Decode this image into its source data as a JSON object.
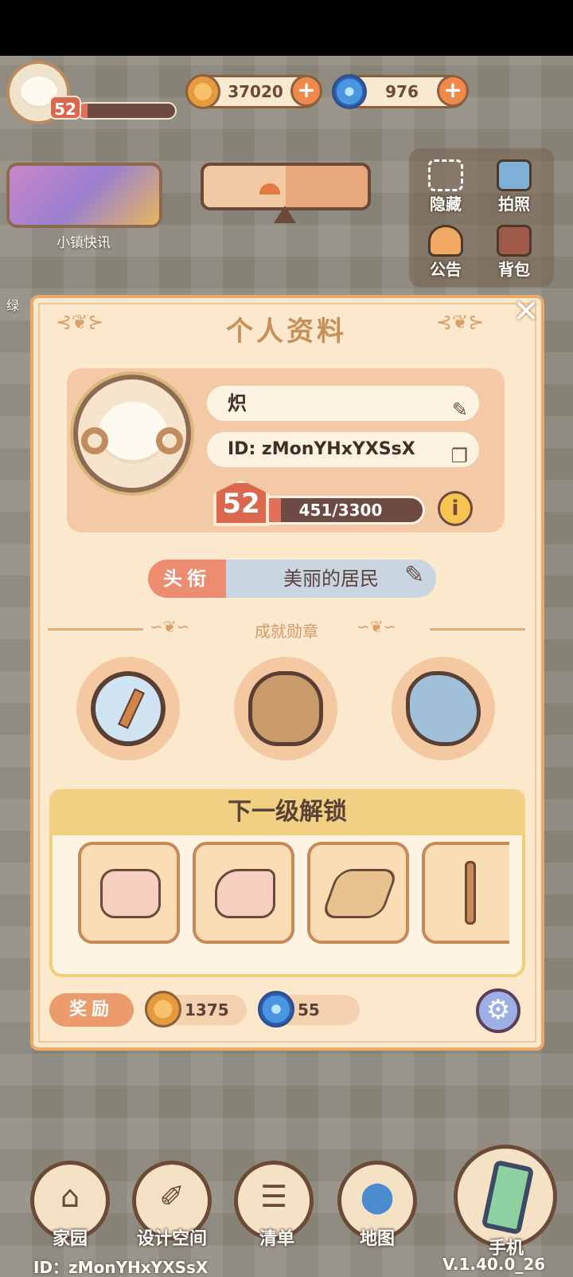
{
  "hud": {
    "level": "52",
    "level_progress": 0.1,
    "coins": "37020",
    "gems": "976",
    "news_label": "小镇快讯",
    "partial_left_label": "绿"
  },
  "side_menu": {
    "hide": "隐藏",
    "photo": "拍照",
    "notice": "公告",
    "bag": "背包"
  },
  "profile": {
    "title": "个人资料",
    "name": "炽",
    "user_id": "ID: zMonYHxYXSsX",
    "level": "52",
    "xp_text": "451/3300",
    "xp_current": 451,
    "xp_max": 3300,
    "info_glyph": "i",
    "title_tag": "头衔",
    "title_value": "美丽的居民",
    "achievements_label": "成就勋章",
    "medals": [
      "compass-icon",
      "money-bag-icon",
      "map-icon"
    ],
    "unlock_header": "下一级解锁",
    "unlock_items": [
      "armchair-icon",
      "curved-sofa-icon",
      "table-setting-icon",
      "coat-rack-icon"
    ],
    "reward_tag": "奖励",
    "reward_coins": "1375",
    "reward_gems": "55"
  },
  "bottom_nav": {
    "home": "家园",
    "design": "设计空间",
    "list": "清单",
    "map": "地图",
    "phone": "手机"
  },
  "footer": {
    "id": "ID：zMonYHxYXSsX",
    "version": "V.1.40.0_26"
  },
  "colors": {
    "dialog_bg": "#fbe8cd",
    "accent": "#e9a96a",
    "level_badge": "#d9684e",
    "title_tag": "#ec8c70"
  }
}
